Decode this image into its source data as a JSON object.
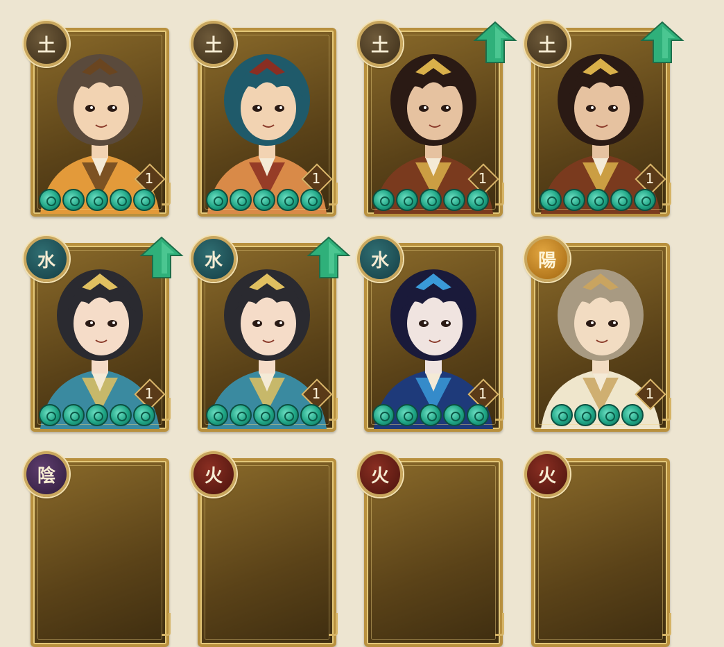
{
  "colors": {
    "background": "#ede5d1",
    "frame_gold": "#b8903e",
    "jade": "#1fa585",
    "upgrade_arrow": "#2fb07a"
  },
  "cards": [
    {
      "id": "hero-1",
      "element_glyph": "土",
      "element_type": "earth",
      "level": "1",
      "stars": 5,
      "upgrade": false,
      "hair": "#5a4a3c",
      "skin": "#f2d3b2",
      "robe": "#e39a3a",
      "accent": "#6a4520"
    },
    {
      "id": "hero-2",
      "element_glyph": "土",
      "element_type": "earth",
      "level": "1",
      "stars": 5,
      "upgrade": false,
      "hair": "#1f5a6a",
      "skin": "#f2d3b2",
      "robe": "#d98a48",
      "accent": "#8a2e22"
    },
    {
      "id": "hero-3",
      "element_glyph": "土",
      "element_type": "earth",
      "level": "1",
      "stars": 5,
      "upgrade": true,
      "hair": "#2a1a14",
      "skin": "#e6c2a0",
      "robe": "#7a3a1e",
      "accent": "#d9b04a"
    },
    {
      "id": "hero-4",
      "element_glyph": "土",
      "element_type": "earth",
      "level": "1",
      "stars": 5,
      "upgrade": true,
      "hair": "#2a1a14",
      "skin": "#e6c2a0",
      "robe": "#7a3a1e",
      "accent": "#d9b04a"
    },
    {
      "id": "hero-5",
      "element_glyph": "水",
      "element_type": "water",
      "level": "1",
      "stars": 5,
      "upgrade": true,
      "hair": "#2a2a30",
      "skin": "#f5dcc8",
      "robe": "#3a8aa0",
      "accent": "#e0c060"
    },
    {
      "id": "hero-6",
      "element_glyph": "水",
      "element_type": "water",
      "level": "1",
      "stars": 5,
      "upgrade": true,
      "hair": "#2a2a30",
      "skin": "#f5dcc8",
      "robe": "#3a8aa0",
      "accent": "#e0c060"
    },
    {
      "id": "hero-7",
      "element_glyph": "水",
      "element_type": "water",
      "level": "1",
      "stars": 5,
      "upgrade": false,
      "hair": "#1a1a3a",
      "skin": "#f0e4e0",
      "robe": "#1e3a7a",
      "accent": "#3a9ad8"
    },
    {
      "id": "hero-8",
      "element_glyph": "陽",
      "element_type": "yang",
      "level": "1",
      "stars": 4,
      "upgrade": false,
      "hair": "#a89a82",
      "skin": "#f2dcc2",
      "robe": "#efe6cc",
      "accent": "#c9a460"
    },
    {
      "id": "hero-9",
      "element_glyph": "陰",
      "element_type": "purple",
      "level": "",
      "stars": 0,
      "upgrade": false,
      "partial": true
    },
    {
      "id": "hero-10",
      "element_glyph": "火",
      "element_type": "red",
      "level": "",
      "stars": 0,
      "upgrade": false,
      "partial": true
    },
    {
      "id": "hero-11",
      "element_glyph": "火",
      "element_type": "red",
      "level": "",
      "stars": 0,
      "upgrade": false,
      "partial": true
    },
    {
      "id": "hero-12",
      "element_glyph": "火",
      "element_type": "red",
      "level": "",
      "stars": 0,
      "upgrade": false,
      "partial": true
    }
  ]
}
